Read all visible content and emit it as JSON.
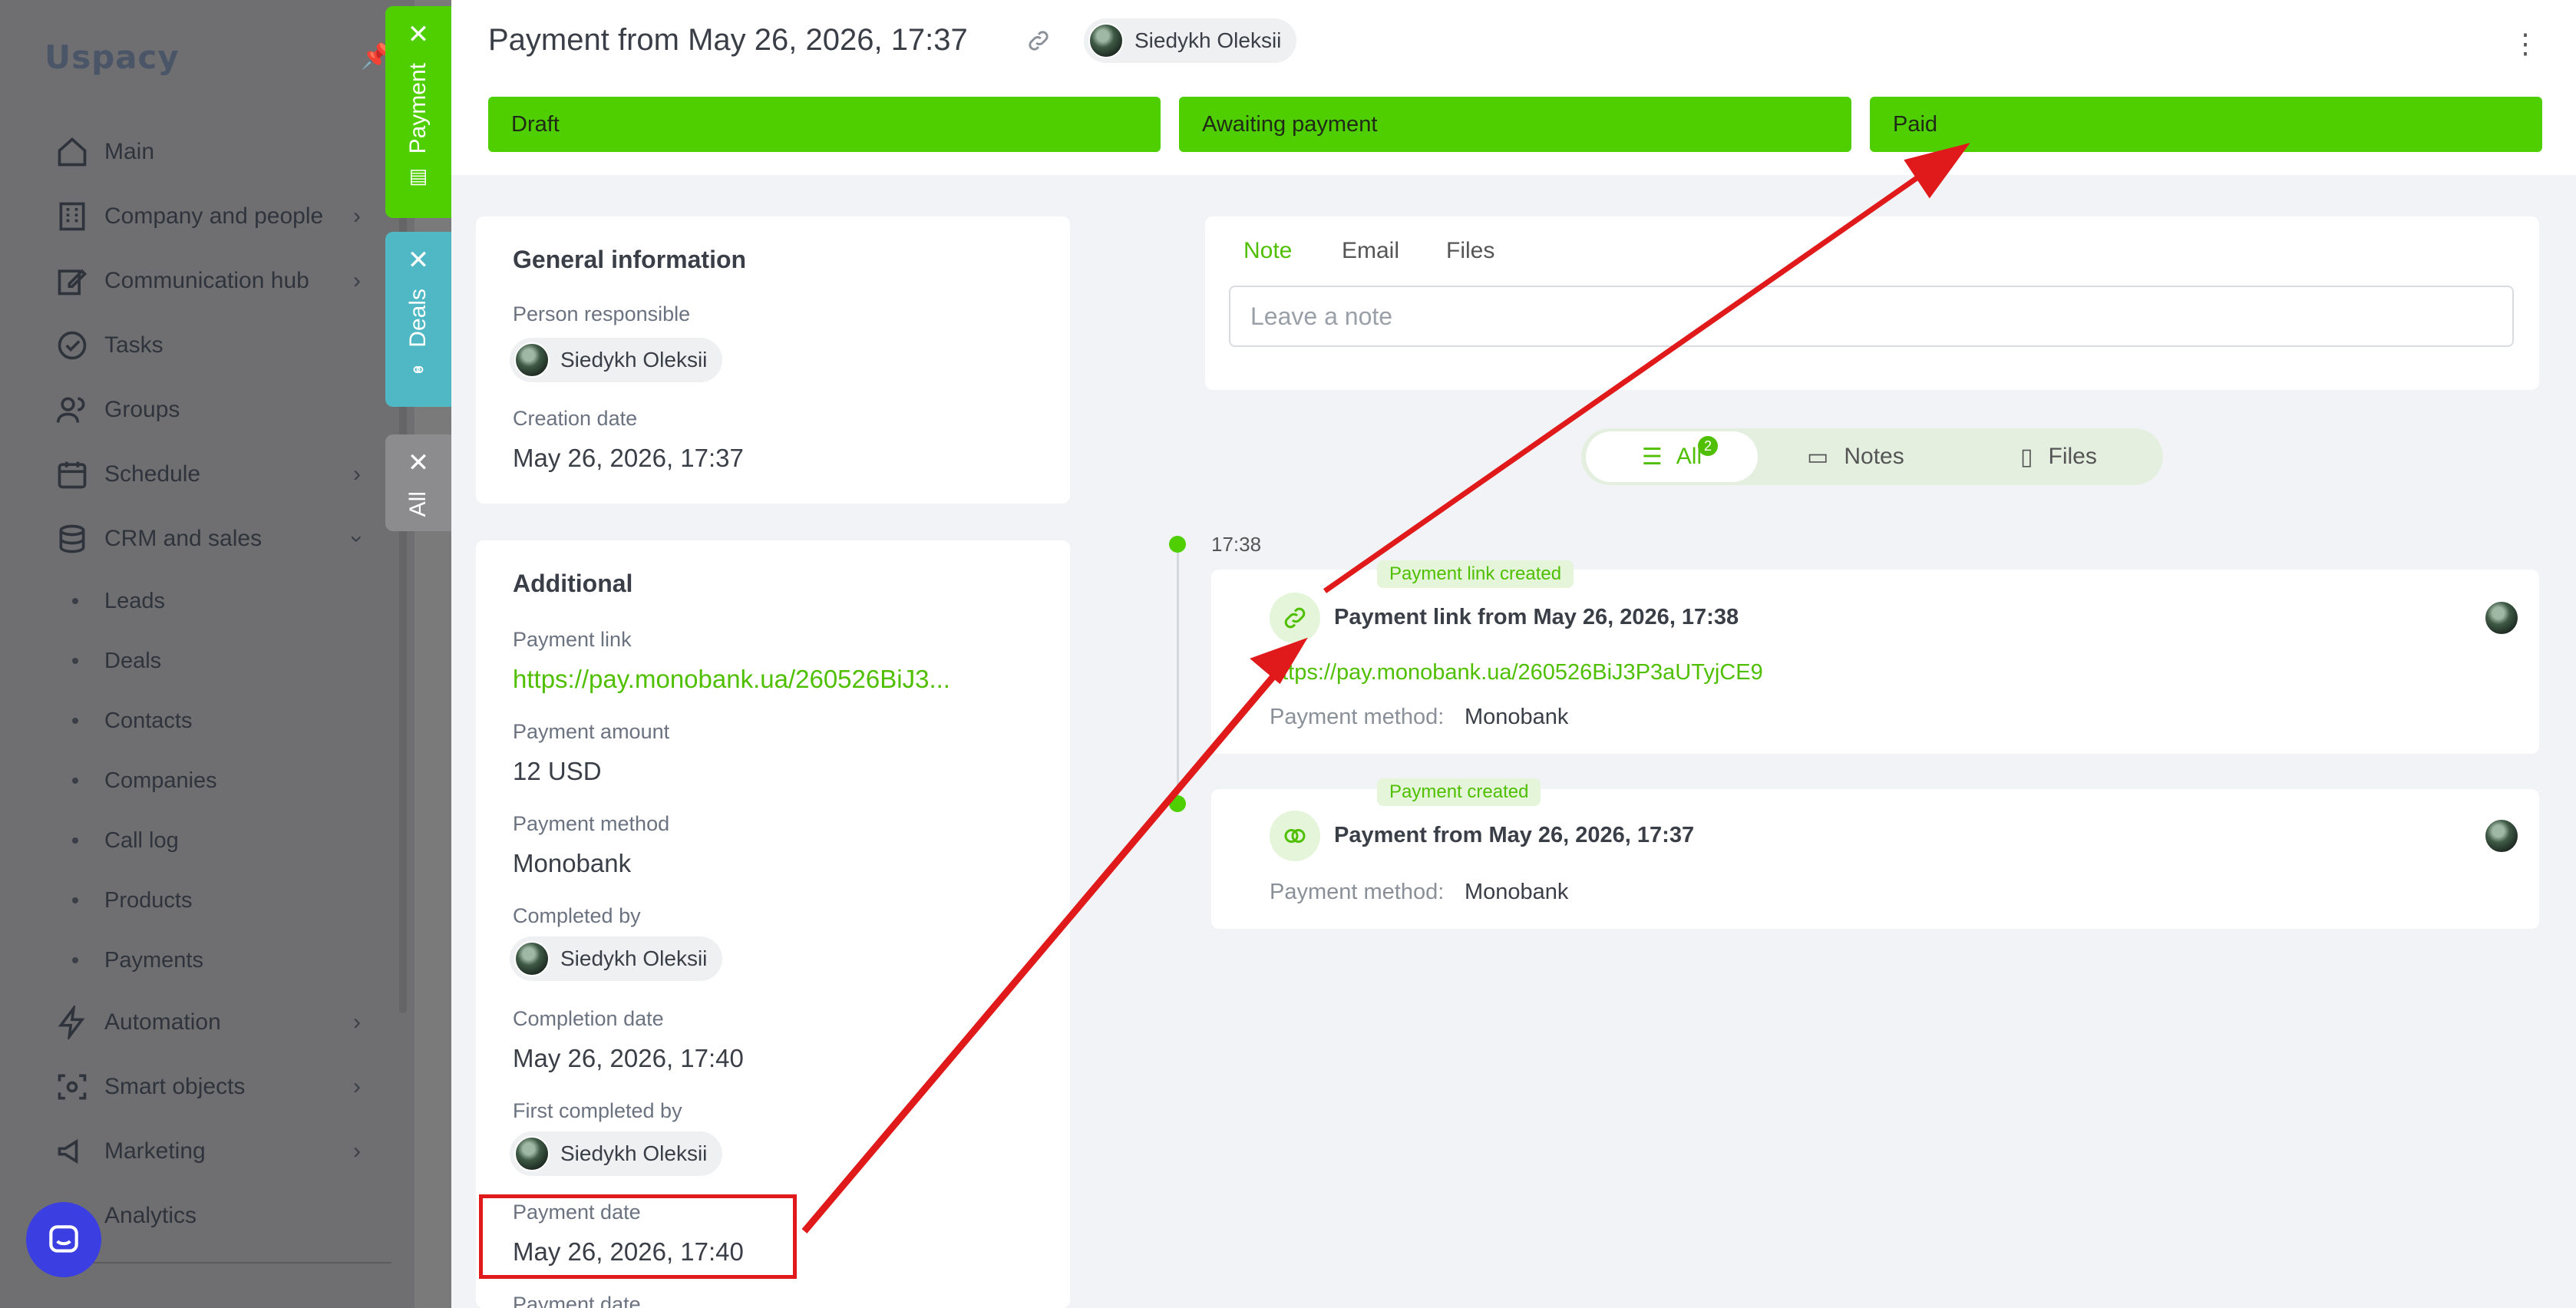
{
  "sidebar": {
    "logo": "Uspacy",
    "items": [
      {
        "label": "Main",
        "icon": "home-icon"
      },
      {
        "label": "Company and people",
        "icon": "building-icon"
      },
      {
        "label": "Communication hub",
        "icon": "edit-icon"
      },
      {
        "label": "Tasks",
        "icon": "check-circle-icon"
      },
      {
        "label": "Groups",
        "icon": "users-icon"
      },
      {
        "label": "Schedule",
        "icon": "calendar-icon"
      },
      {
        "label": "CRM and sales",
        "icon": "database-icon"
      }
    ],
    "crm_sub": [
      "Leads",
      "Deals",
      "Contacts",
      "Companies",
      "Call log",
      "Products",
      "Payments"
    ],
    "items_bottom": [
      {
        "label": "Automation",
        "icon": "lightning-icon"
      },
      {
        "label": "Smart objects",
        "icon": "scan-icon"
      },
      {
        "label": "Marketing",
        "icon": "megaphone-icon"
      },
      {
        "label": "Analytics",
        "icon": "chart-icon"
      }
    ]
  },
  "vtabs": {
    "payment": "Payment",
    "deals": "Deals",
    "all": "All"
  },
  "header": {
    "title": "Payment from May 26, 2026, 17:37",
    "user": "Siedykh Oleksii",
    "stages": [
      "Draft",
      "Awaiting payment",
      "Paid"
    ]
  },
  "general": {
    "title": "General information",
    "responsible_label": "Person responsible",
    "responsible": "Siedykh Oleksii",
    "creation_label": "Creation date",
    "creation": "May 26, 2026, 17:37"
  },
  "additional": {
    "title": "Additional",
    "link_label": "Payment link",
    "link": "https://pay.monobank.ua/260526BiJ3...",
    "amount_label": "Payment amount",
    "amount": "12 USD",
    "method_label": "Payment method",
    "method": "Monobank",
    "completed_by_label": "Completed by",
    "completed_by": "Siedykh Oleksii",
    "completion_label": "Completion date",
    "completion": "May 26, 2026, 17:40",
    "first_completed_label": "First completed by",
    "first_completed": "Siedykh Oleksii",
    "payment_date_label": "Payment date",
    "payment_date": "May 26, 2026, 17:40",
    "cut_label": "Payment date"
  },
  "composer": {
    "tabs": [
      "Note",
      "Email",
      "Files"
    ],
    "placeholder": "Leave a note"
  },
  "filters": {
    "all": "All",
    "all_count": "2",
    "notes": "Notes",
    "files": "Files"
  },
  "timeline": {
    "time": "17:38",
    "events": [
      {
        "tag": "Payment link created",
        "title": "Payment link from May 26, 2026, 17:38",
        "link": "https://pay.monobank.ua/260526BiJ3P3aUTyjCE9",
        "method_label": "Payment method:",
        "method": "Monobank"
      },
      {
        "tag": "Payment created",
        "title": "Payment from May 26, 2026, 17:37",
        "method_label": "Payment method:",
        "method": "Monobank"
      }
    ]
  },
  "colors": {
    "accent": "#4fcf00",
    "annotation": "#e01a1a",
    "deals_tab": "#4fb8c4"
  }
}
